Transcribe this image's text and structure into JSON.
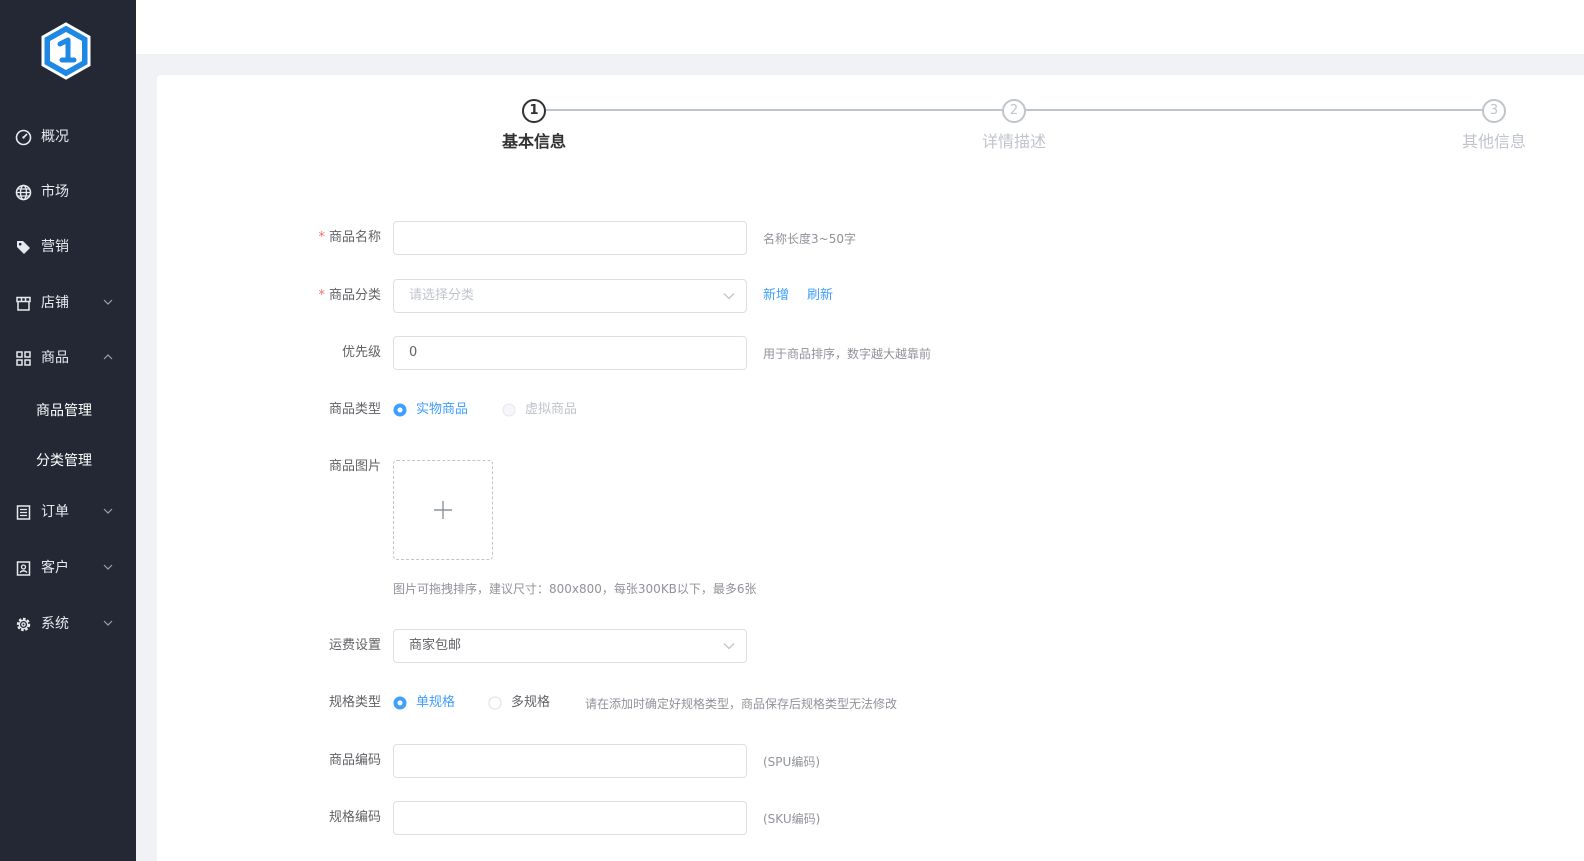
{
  "sidebar": {
    "items": [
      {
        "label": "概况",
        "icon": "dashboard-icon"
      },
      {
        "label": "市场",
        "icon": "globe-icon"
      },
      {
        "label": "营销",
        "icon": "tag-icon"
      },
      {
        "label": "店铺",
        "icon": "store-icon",
        "expandable": true
      },
      {
        "label": "商品",
        "icon": "grid-icon",
        "expanded": true,
        "children": [
          "商品管理",
          "分类管理"
        ]
      },
      {
        "label": "订单",
        "icon": "order-list-icon",
        "expandable": true
      },
      {
        "label": "客户",
        "icon": "customer-icon",
        "expandable": true
      },
      {
        "label": "系统",
        "icon": "gear-icon",
        "expandable": true
      }
    ],
    "submenu": [
      "商品管理",
      "分类管理"
    ]
  },
  "steps": [
    {
      "number": "1",
      "title": "基本信息",
      "active": true
    },
    {
      "number": "2",
      "title": "详情描述",
      "active": false
    },
    {
      "number": "3",
      "title": "其他信息",
      "active": false
    }
  ],
  "form": {
    "name": {
      "label": "商品名称",
      "value": "",
      "hint": "名称长度3~50字"
    },
    "category": {
      "label": "商品分类",
      "placeholder": "请选择分类",
      "add": "新增",
      "refresh": "刷新"
    },
    "priority": {
      "label": "优先级",
      "value": "0",
      "hint": "用于商品排序，数字越大越靠前"
    },
    "type": {
      "label": "商品类型",
      "options": [
        "实物商品",
        "虚拟商品"
      ],
      "selected": "实物商品"
    },
    "images": {
      "label": "商品图片",
      "hint": "图片可拖拽排序，建议尺寸：800x800，每张300KB以下，最多6张"
    },
    "shipping": {
      "label": "运费设置",
      "value": "商家包邮"
    },
    "spec_type": {
      "label": "规格类型",
      "options": [
        "单规格",
        "多规格"
      ],
      "selected": "单规格",
      "hint": "请在添加时确定好规格类型，商品保存后规格类型无法修改"
    },
    "spu": {
      "label": "商品编码",
      "value": "",
      "hint": "(SPU编码)"
    },
    "sku": {
      "label": "规格编码",
      "value": "",
      "hint": "(SKU编码)"
    }
  },
  "colors": {
    "sidebar": "#232834",
    "primary": "#409eff",
    "required": "#f56c6c"
  }
}
